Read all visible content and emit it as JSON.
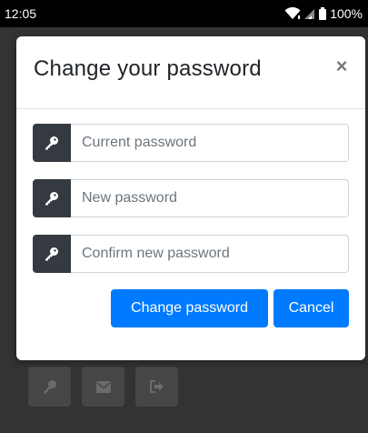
{
  "status_bar": {
    "time": "12:05",
    "battery_percent": "100%",
    "icons": [
      "wifi-icon",
      "signal-icon",
      "battery-icon"
    ]
  },
  "modal": {
    "title": "Change your password",
    "close_label": "×",
    "fields": [
      {
        "icon": "key-icon",
        "placeholder": "Current password",
        "value": ""
      },
      {
        "icon": "key-icon",
        "placeholder": "New password",
        "value": ""
      },
      {
        "icon": "key-icon",
        "placeholder": "Confirm new password",
        "value": ""
      }
    ],
    "submit_label": "Change password",
    "cancel_label": "Cancel"
  },
  "background_toolbar": {
    "icons": [
      "key-icon",
      "envelope-icon",
      "sign-out-icon"
    ]
  },
  "colors": {
    "primary": "#007bff",
    "addon": "#343a40",
    "backdrop": "#333333",
    "status_bar": "#000000"
  }
}
